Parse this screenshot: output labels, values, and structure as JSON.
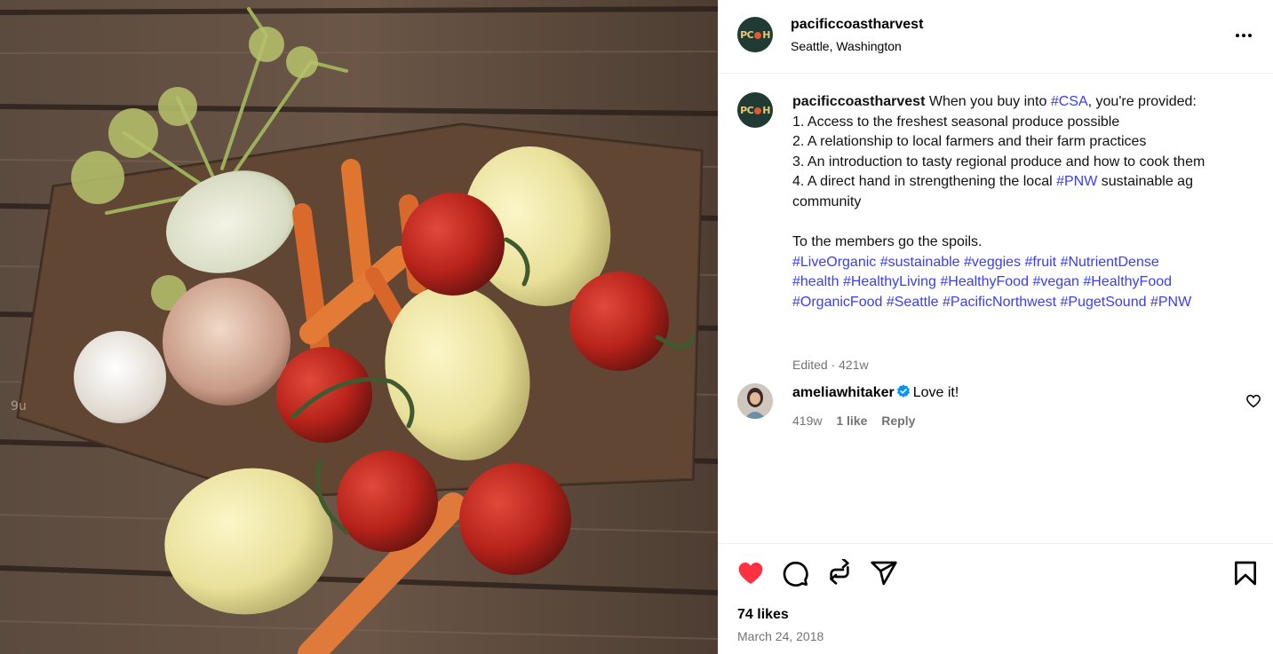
{
  "post": {
    "author": "pacificcoastharvest",
    "location": "Seattle, Washington",
    "avatar_logo": "PCH"
  },
  "caption": {
    "username": "pacificcoastharvest",
    "line1_pre": " When you buy into ",
    "tag_csa": "#CSA",
    "line1_post": ", you're provided:",
    "item1": "1. Access to the freshest seasonal produce possible",
    "item2": "2. A relationship to local farmers and their farm practices",
    "item3": "3. An introduction to tasty regional produce and how to cook them",
    "item4_pre": "4. A direct hand in strengthening the local ",
    "tag_pnw": "#PNW",
    "item4_post": " sustainable ag community",
    "closing": "To the members go the spoils.",
    "hashtags": [
      "#LiveOrganic",
      "#sustainable",
      "#veggies",
      "#fruit",
      "#NutrientDense",
      "#health",
      "#HealthyLiving",
      "#HealthyFood",
      "#vegan",
      "#HealthyFood",
      "#OrganicFood",
      "#Seattle",
      "#PacificNorthwest",
      "#PugetSound",
      "#PNW"
    ],
    "meta": "Edited · 421w"
  },
  "comment": {
    "username": "ameliawhitaker",
    "text": "Love it!",
    "age": "419w",
    "likes": "1 like",
    "reply": "Reply"
  },
  "footer": {
    "likes": "74 likes",
    "date": "March 24, 2018"
  },
  "colors": {
    "hashtag": "#3a3ef0",
    "like_red": "#ff3040",
    "verified_blue": "#0095f6"
  },
  "icons": [
    "more-options-icon",
    "heart-filled-icon",
    "comment-icon",
    "repost-icon",
    "share-icon",
    "save-bookmark-icon",
    "verified-badge-icon",
    "heart-outline-icon"
  ]
}
